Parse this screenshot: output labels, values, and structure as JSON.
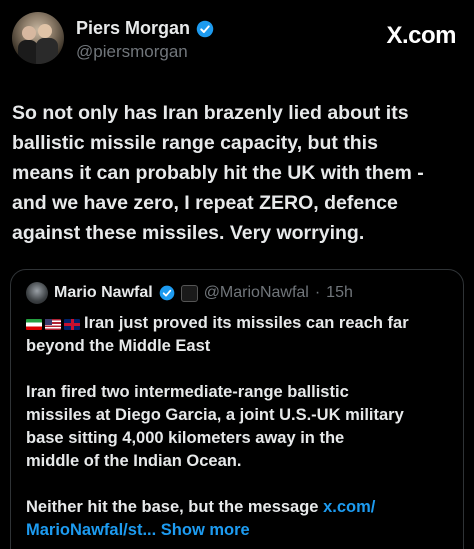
{
  "author": {
    "name": "Piers Morgan",
    "handle": "@piersmorgan"
  },
  "brand": "X.com",
  "tweet": {
    "lines": [
      "So not only has Iran brazenly lied about its",
      "ballistic missile range capacity, but this",
      "means it can probably hit the UK with them -",
      "and we have zero, I repeat ZERO, defence",
      "against these missiles. Very worrying."
    ]
  },
  "quote": {
    "name": "Mario Nawfal",
    "handle": "@MarioNawfal",
    "separator": "·",
    "time": "15h",
    "flags": [
      "iran-flag",
      "us-flag",
      "uk-flag"
    ],
    "headline_lines": [
      "Iran just proved its missiles can reach far",
      "beyond the Middle East"
    ],
    "paragraph_lines": [
      "Iran fired two intermediate-range ballistic",
      "missiles at Diego Garcia, a joint U.S.-UK military",
      "base sitting 4,000 kilometers away in the",
      "middle of the Indian Ocean."
    ],
    "last_line_1_text": "Neither hit the base, but the message ",
    "link_1": "x.com/",
    "link_2": "MarioNawfal/st...",
    "show_more": "Show more"
  },
  "colors": {
    "background": "#000000",
    "text": "#e7e9ea",
    "muted": "#71767b",
    "link": "#1d9bf0",
    "border": "#2f3336"
  }
}
